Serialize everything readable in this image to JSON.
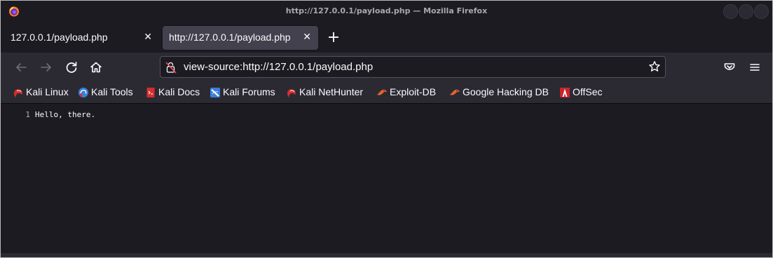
{
  "window": {
    "title": "http://127.0.0.1/payload.php — Mozilla Firefox"
  },
  "tabs": [
    {
      "label": "127.0.0.1/payload.php",
      "close": "✕",
      "active": false
    },
    {
      "label": "http://127.0.0.1/payload.php",
      "close": "✕",
      "active": true
    }
  ],
  "new_tab_label": "+",
  "urlbar": {
    "value": "view-source:http://127.0.0.1/payload.php"
  },
  "bookmarks": [
    {
      "label": "Kali Linux",
      "icon": "kali-dragon-icon"
    },
    {
      "label": "Kali Tools",
      "icon": "kali-tools-icon"
    },
    {
      "label": "Kali Docs",
      "icon": "kali-docs-icon"
    },
    {
      "label": "Kali Forums",
      "icon": "kali-forums-icon"
    },
    {
      "label": "Kali NetHunter",
      "icon": "kali-nethunter-icon"
    },
    {
      "label": "Exploit-DB",
      "icon": "exploit-db-icon"
    },
    {
      "label": "Google Hacking DB",
      "icon": "google-hacking-db-icon"
    },
    {
      "label": "OffSec",
      "icon": "offsec-icon"
    }
  ],
  "source": {
    "lines": [
      {
        "number": "1",
        "text": "Hello, there."
      }
    ]
  },
  "colors": {
    "chrome_dark": "#1c1b22",
    "toolbar": "#2b2a33",
    "active_tab": "#42414d",
    "text": "#fbfbfe",
    "kali_red": "#d72d2d",
    "kali_blue": "#3b7fd8"
  }
}
